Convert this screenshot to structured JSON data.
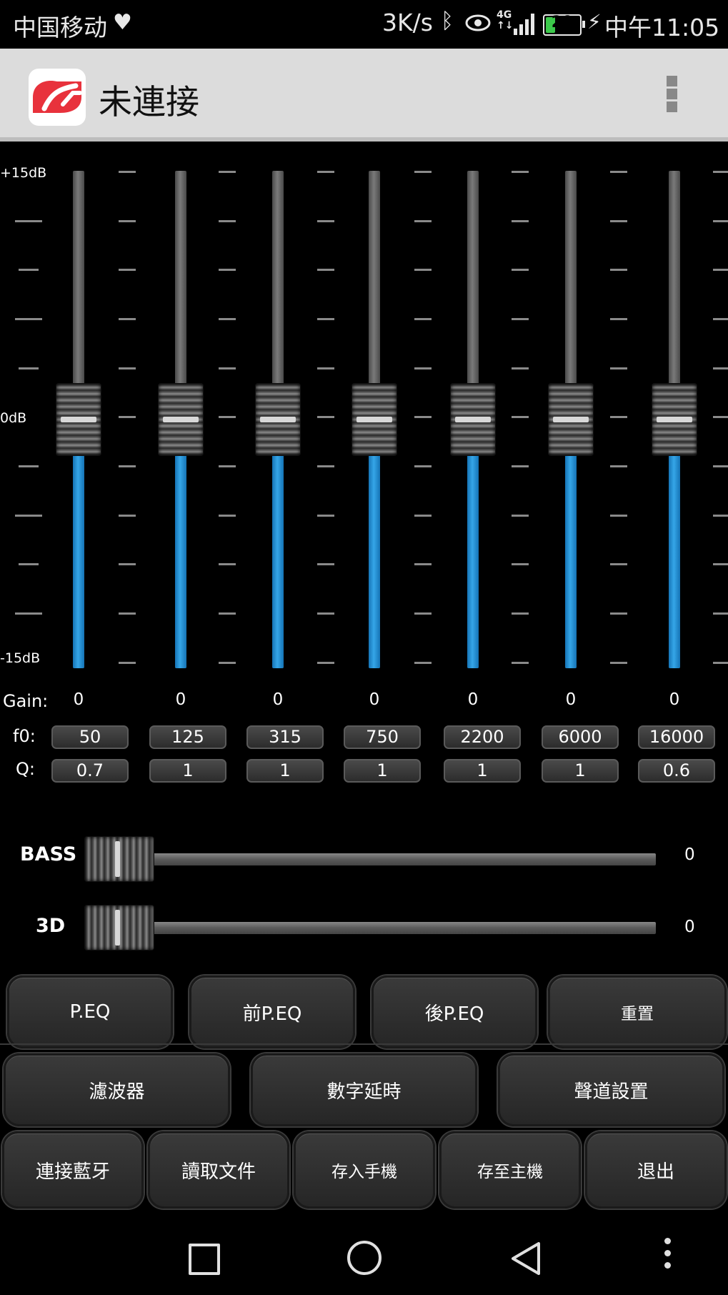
{
  "status_bar": {
    "carrier": "中国移动",
    "speed": "3K/s",
    "battery": "29",
    "time": "中午11:05",
    "icons": [
      "heart-rate-icon",
      "bluetooth-icon",
      "eye-icon",
      "4g-icon",
      "signal-icon",
      "battery-icon",
      "charging-icon"
    ]
  },
  "app_bar": {
    "title": "未連接",
    "logo": "app-logo",
    "brand_color": "#e8323c"
  },
  "eq": {
    "scale": {
      "top": "+15dB",
      "mid": "0dB",
      "bottom": "-15dB"
    },
    "gain_label": "Gain:",
    "f0_label": "f0:",
    "q_label": "Q:",
    "bands": [
      {
        "gain": "0",
        "f0": "50",
        "q": "0.7",
        "level": 0.5
      },
      {
        "gain": "0",
        "f0": "125",
        "q": "1",
        "level": 0.5
      },
      {
        "gain": "0",
        "f0": "315",
        "q": "1",
        "level": 0.5
      },
      {
        "gain": "0",
        "f0": "750",
        "q": "1",
        "level": 0.5
      },
      {
        "gain": "0",
        "f0": "2200",
        "q": "1",
        "level": 0.5
      },
      {
        "gain": "0",
        "f0": "6000",
        "q": "1",
        "level": 0.5
      },
      {
        "gain": "0",
        "f0": "16000",
        "q": "0.6",
        "level": 0.5
      }
    ],
    "fill_color": "#35a6e8"
  },
  "bass": {
    "label": "BASS",
    "value": "0",
    "level": 0
  },
  "surround": {
    "label": "3D",
    "value": "0",
    "level": 0
  },
  "buttons": {
    "row1": [
      "P.EQ",
      "前P.EQ",
      "後P.EQ",
      "重置"
    ],
    "row2": [
      "濾波器",
      "數字延時",
      "聲道設置"
    ],
    "row3": [
      "連接藍牙",
      "讀取文件",
      "存入手機",
      "存至主機",
      "退出"
    ]
  },
  "nav_bar": {
    "icons": [
      "recent-apps-icon",
      "home-icon",
      "back-icon",
      "more-icon"
    ]
  }
}
